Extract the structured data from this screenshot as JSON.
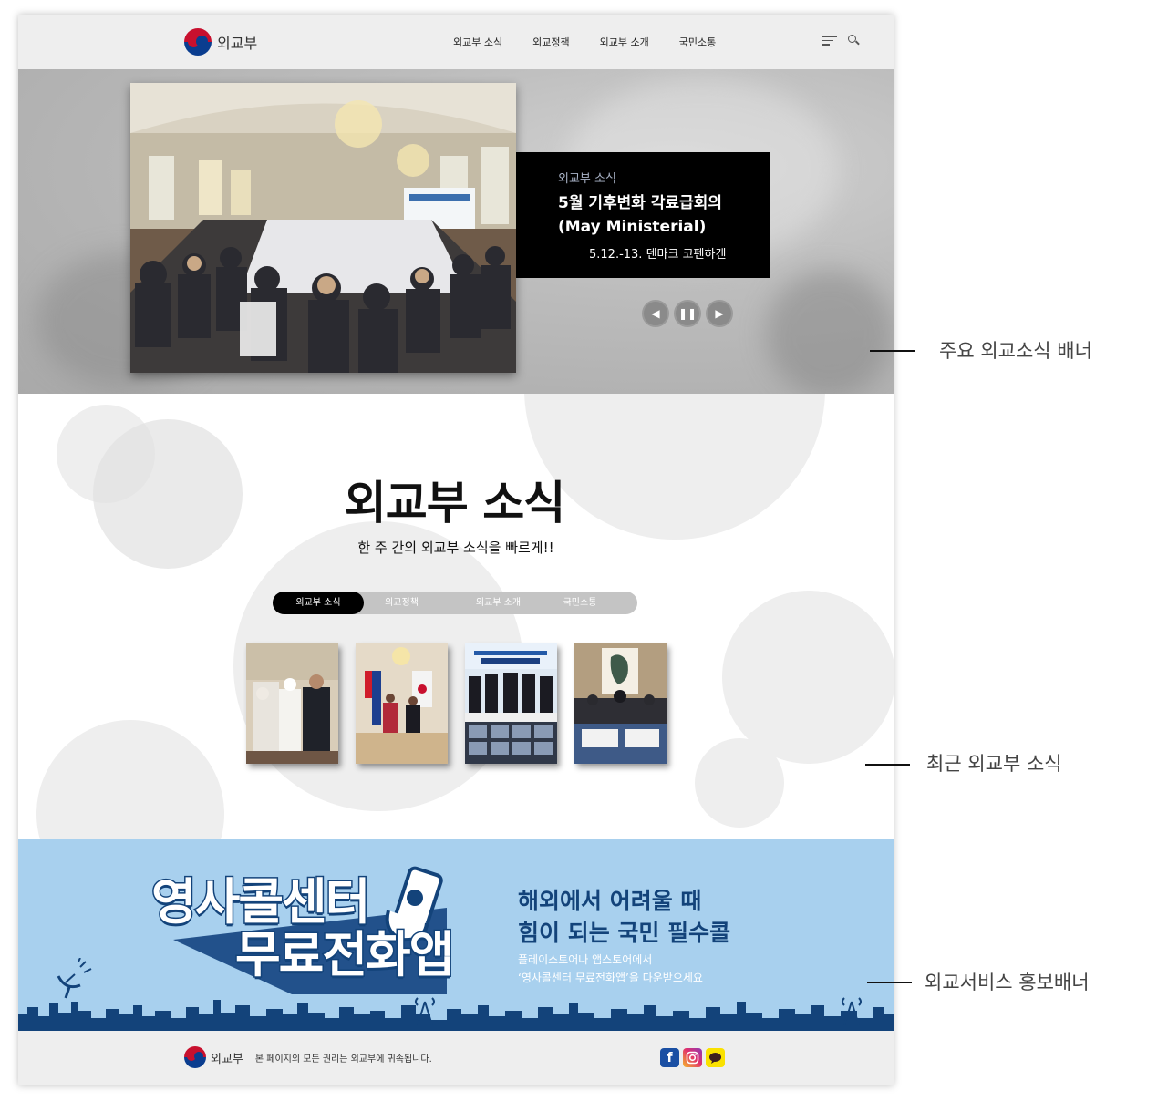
{
  "header": {
    "logo_text": "외교부",
    "nav": [
      "외교부 소식",
      "외교정책",
      "외교부 소개",
      "국민소통"
    ]
  },
  "hero": {
    "category": "외교부 소식",
    "title_line1": "5월 기후변화 각료급회의",
    "title_line2": "(May Ministerial)",
    "date": "5.12.-13. 덴마크 코펜하겐",
    "controls": [
      "prev-icon",
      "pause-icon",
      "next-icon"
    ]
  },
  "news": {
    "title": "외교부 소식",
    "subtitle": "한 주 간의 외교부 소식을 빠르게!!",
    "tabs": [
      "외교부 소식",
      "외교정책",
      "외교부 소개",
      "국민소통"
    ],
    "active_tab": 0
  },
  "promo": {
    "big_line1": "영사콜센터",
    "big_line2": "무료전화앱",
    "heading_line1": "해외에서 어려울 때",
    "heading_line2": "힘이 되는 국민 필수콜",
    "desc_line1": "플레이스토어나 앱스토어에서",
    "desc_line2": "‘영사콜센터 무료전화앱’을 다운받으세요"
  },
  "footer": {
    "logo_text": "외교부",
    "copyright": "본 페이지의 모든 권리는 외교부에 귀속됩니다.",
    "socials": [
      "facebook-icon",
      "instagram-icon",
      "kakaotalk-icon"
    ]
  },
  "annotations": {
    "banner": "주요 외교소식 배너",
    "news": "최근 외교부 소식",
    "promo": "외교서비스 홍보배너"
  }
}
